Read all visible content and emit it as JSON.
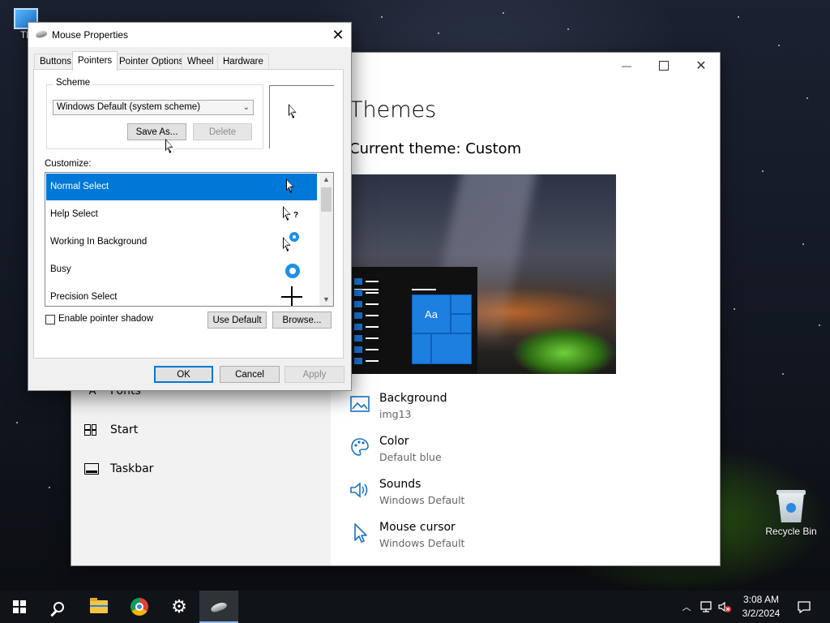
{
  "desktop": {
    "this_pc_label": "Th",
    "recycle_bin_label": "Recycle Bin"
  },
  "settings": {
    "window_controls": {
      "minimize": "—",
      "maximize": "",
      "close": "✕"
    },
    "sidebar": [
      {
        "label": "Fonts",
        "icon": "fonts-icon"
      },
      {
        "label": "Start",
        "icon": "start-icon"
      },
      {
        "label": "Taskbar",
        "icon": "taskbar-icon"
      }
    ],
    "heading": "Themes",
    "current_theme": "Current theme: Custom",
    "preview_tile_label": "Aa",
    "options": [
      {
        "title": "Background",
        "value": "img13",
        "icon": "picture-icon"
      },
      {
        "title": "Color",
        "value": "Default blue",
        "icon": "palette-icon"
      },
      {
        "title": "Sounds",
        "value": "Windows Default",
        "icon": "speaker-icon"
      },
      {
        "title": "Mouse cursor",
        "value": "Windows Default",
        "icon": "cursor-icon"
      }
    ]
  },
  "mouse_dialog": {
    "title": "Mouse Properties",
    "close": "✕",
    "tabs": [
      "Buttons",
      "Pointers",
      "Pointer Options",
      "Wheel",
      "Hardware"
    ],
    "active_tab": "Pointers",
    "scheme": {
      "legend": "Scheme",
      "selected": "Windows Default (system scheme)",
      "save_as": "Save As...",
      "delete": "Delete"
    },
    "customize_label": "Customize:",
    "pointers": [
      {
        "name": "Normal Select",
        "selected": true,
        "cursor": "arrow"
      },
      {
        "name": "Help Select",
        "selected": false,
        "cursor": "help"
      },
      {
        "name": "Working In Background",
        "selected": false,
        "cursor": "working"
      },
      {
        "name": "Busy",
        "selected": false,
        "cursor": "busy"
      },
      {
        "name": "Precision Select",
        "selected": false,
        "cursor": "crosshair"
      }
    ],
    "enable_shadow_label": "Enable pointer shadow",
    "enable_shadow_checked": false,
    "use_default": "Use Default",
    "browse": "Browse...",
    "ok": "OK",
    "cancel": "Cancel",
    "apply": "Apply"
  },
  "taskbar": {
    "time": "3:08 AM",
    "date": "3/2/2024",
    "apps": [
      "start-icon",
      "search-icon",
      "file-explorer-icon",
      "chrome-icon",
      "settings-icon",
      "mouse-properties-icon"
    ],
    "active_app": "mouse-properties-icon"
  },
  "colors": {
    "accent": "#0078d7",
    "settings_icon_blue": "#1a73c9",
    "taskbar": "#101418"
  }
}
